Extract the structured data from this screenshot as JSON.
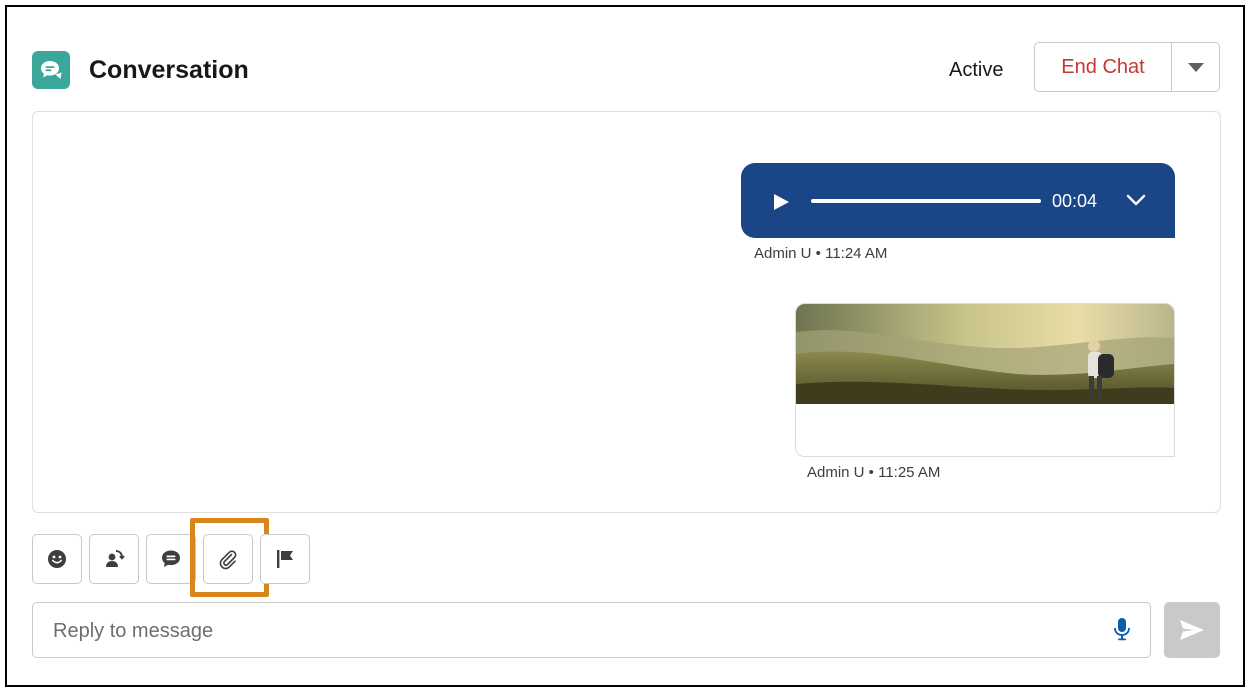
{
  "header": {
    "title": "Conversation",
    "status": "Active",
    "end_chat_label": "End Chat",
    "header_icon": "chat-bubble-icon"
  },
  "messages": [
    {
      "type": "audio",
      "duration": "00:04",
      "sender": "Admin U",
      "time": "11:24 AM",
      "meta": "Admin U • 11:24 AM",
      "bubble_color": "#1a4586"
    },
    {
      "type": "image",
      "image_description_icon": "photo-icon",
      "sender": "Admin U",
      "time": "11:25 AM",
      "meta": "Admin U • 11:25 AM"
    }
  ],
  "toolbar": {
    "buttons": [
      {
        "name": "emoji",
        "icon": "smiley-icon"
      },
      {
        "name": "transfer",
        "icon": "transfer-person-icon"
      },
      {
        "name": "quick-text",
        "icon": "speech-bubble-icon"
      },
      {
        "name": "attach-file",
        "icon": "paperclip-icon",
        "highlighted": true
      },
      {
        "name": "flag",
        "icon": "flag-icon"
      }
    ],
    "highlight_color": "#d7861d"
  },
  "composer": {
    "placeholder": "Reply to message",
    "value": "",
    "mic_icon": "microphone-icon",
    "send_icon": "send-arrow-icon"
  },
  "colors": {
    "accent_teal": "#3ba79b",
    "end_chat_red": "#c23934",
    "audio_blue": "#1a4586"
  }
}
